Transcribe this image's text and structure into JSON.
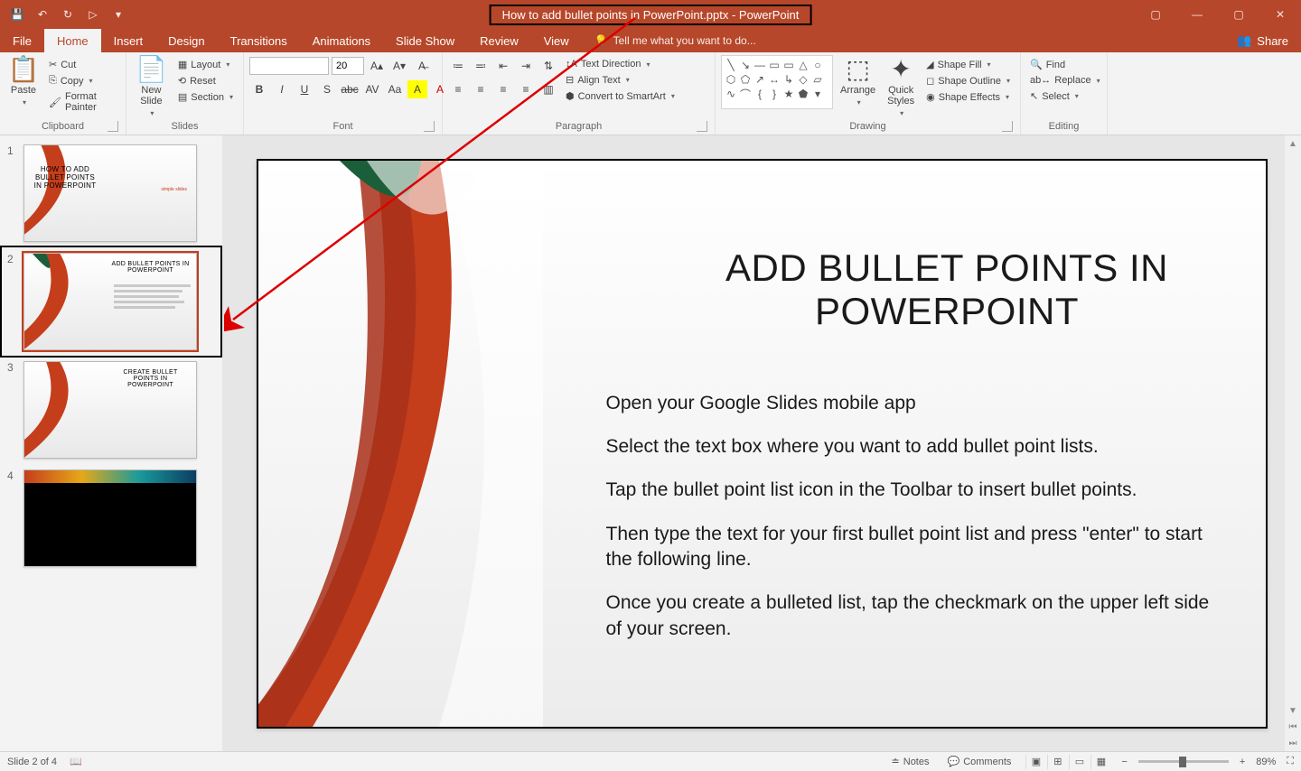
{
  "app": {
    "title": "How to add bullet points in PowerPoint.pptx - PowerPoint"
  },
  "qat": {
    "save": "💾",
    "undo": "↶",
    "redo": "↻",
    "start": "▷",
    "more": "▾"
  },
  "tabs": [
    "File",
    "Home",
    "Insert",
    "Design",
    "Transitions",
    "Animations",
    "Slide Show",
    "Review",
    "View"
  ],
  "tabs_active_index": 1,
  "tell_me": "Tell me what you want to do...",
  "share": "Share",
  "ribbon": {
    "clipboard": {
      "label": "Clipboard",
      "paste": "Paste",
      "cut": "Cut",
      "copy": "Copy",
      "fmt": "Format Painter"
    },
    "slides": {
      "label": "Slides",
      "new": "New\nSlide",
      "layout": "Layout",
      "reset": "Reset",
      "section": "Section"
    },
    "font": {
      "label": "Font",
      "size": "20"
    },
    "paragraph": {
      "label": "Paragraph",
      "dir": "Text Direction",
      "align": "Align Text",
      "smart": "Convert to SmartArt"
    },
    "drawing": {
      "label": "Drawing",
      "arrange": "Arrange",
      "styles": "Quick\nStyles",
      "fill": "Shape Fill",
      "outline": "Shape Outline",
      "effects": "Shape Effects"
    },
    "editing": {
      "label": "Editing",
      "find": "Find",
      "replace": "Replace",
      "select": "Select"
    }
  },
  "thumbs": [
    {
      "n": "1",
      "title": "HOW TO ADD BULLET POINTS IN POWERPOINT",
      "sub": "simple slides"
    },
    {
      "n": "2",
      "title": "ADD BULLET POINTS IN POWERPOINT"
    },
    {
      "n": "3",
      "title": "CREATE BULLET POINTS IN POWERPOINT"
    },
    {
      "n": "4",
      "title": ""
    }
  ],
  "slide": {
    "title": "ADD BULLET POINTS IN POWERPOINT",
    "lines": [
      "Open your Google Slides mobile app",
      "Select the text box where you want to add bullet point lists.",
      "Tap the bullet point list icon in the Toolbar to insert bullet points.",
      "Then type the text for your first bullet point list and press \"enter\" to start the following line.",
      "Once you create a bulleted list, tap the checkmark on the upper left side of your screen."
    ]
  },
  "status": {
    "left": "Slide 2 of 4",
    "notes": "Notes",
    "comments": "Comments",
    "zoom": "89%"
  }
}
